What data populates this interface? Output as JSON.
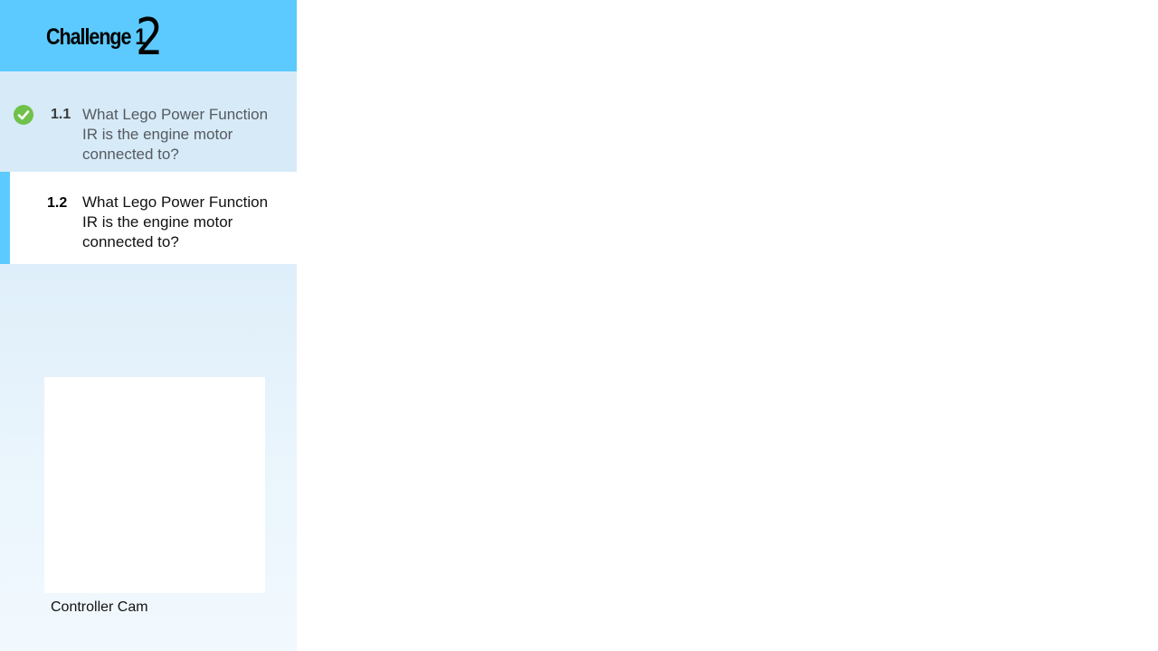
{
  "header": {
    "title": "Challenge 1",
    "overlay": "2",
    "color": "#5ccafe"
  },
  "questions": [
    {
      "number": "1.1",
      "text": "What Lego Power Function IR is the engine motor connected to?",
      "status": "completed",
      "status_icon": "check-circle-icon",
      "status_color": "#6fc14a"
    },
    {
      "number": "1.2",
      "text": "What Lego Power Function IR is the engine motor connected to?",
      "status": "active",
      "accent_color": "#5ccafe"
    }
  ],
  "camera": {
    "label": "Controller Cam"
  }
}
